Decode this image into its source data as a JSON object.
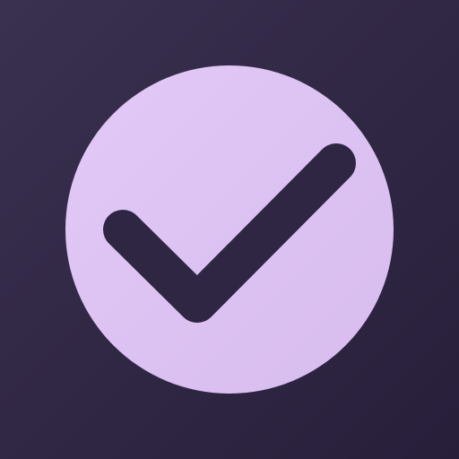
{
  "icon": {
    "name": "checkmark-icon",
    "colors": {
      "background_start": "#3a3050",
      "background_end": "#271f3a",
      "circle_light": "#e2c9f6",
      "circle_dark": "#d7bcee",
      "checkmark": "#2e2643"
    }
  }
}
